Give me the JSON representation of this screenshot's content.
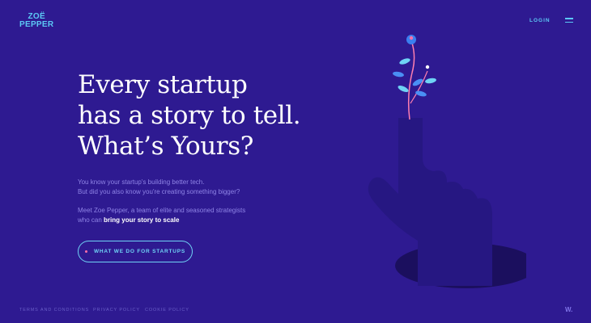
{
  "header": {
    "logo_line1": "ZOË",
    "logo_line2": "PEPPER",
    "login_label": "LOGIN"
  },
  "hero": {
    "headline": [
      "Every startup",
      "has a story to tell.",
      "What’s Yours?"
    ],
    "para1": [
      "You know your startup's building better tech.",
      "But did you also know you're creating something bigger?"
    ],
    "para2_line1": "Meet Zoe Pepper, a team of elite and seasoned strategists",
    "para2_line2_prefix": "who can ",
    "para2_line2_bold": "bring your story to scale",
    "cta_label": "WHAT WE DO FOR STARTUPS"
  },
  "footer": {
    "links": [
      "TERMS AND CONDITIONS",
      "PRIVACY POLICY",
      "COOKIE POLICY"
    ],
    "credit": "W."
  },
  "icons": [
    "hamburger-menu-icon",
    "plant-hand-illustration"
  ],
  "colors": {
    "background": "#2e1a91",
    "accent": "#5cc8f5",
    "cta_dot": "#ff6fa8",
    "body_text": "#8f84e6"
  }
}
